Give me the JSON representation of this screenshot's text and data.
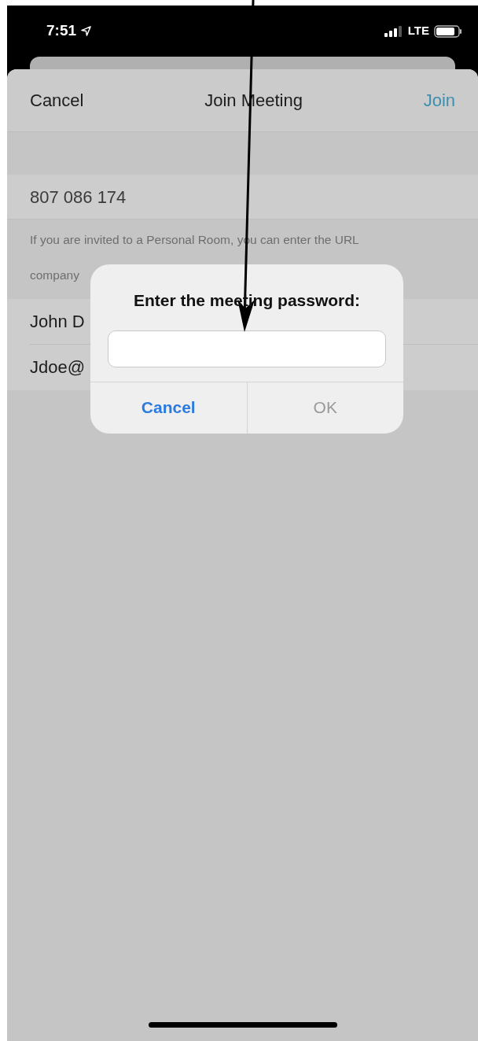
{
  "status_bar": {
    "time": "7:51",
    "network": "LTE"
  },
  "nav": {
    "cancel": "Cancel",
    "title": "Join Meeting",
    "join": "Join"
  },
  "meeting_id": "807 086 174",
  "help_lines": [
    "If you are invited to a Personal Room, you can enter the URL",
    "company"
  ],
  "fields": [
    "John D",
    "Jdoe@"
  ],
  "dialog": {
    "title": "Enter the meeting password:",
    "buttons": [
      {
        "label": "Cancel",
        "disabled": false
      },
      {
        "label": "OK",
        "disabled": true
      }
    ]
  }
}
